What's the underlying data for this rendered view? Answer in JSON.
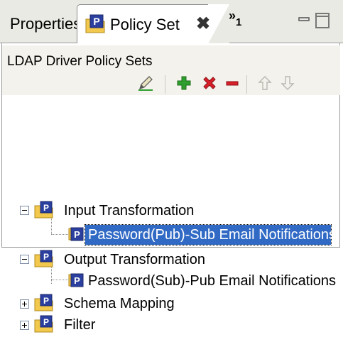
{
  "tabs": {
    "properties_label": "Properties",
    "active_label": "Policy Set",
    "close_glyph": "✖",
    "overflow_glyph": "»",
    "overflow_count": "1"
  },
  "panel": {
    "title": "LDAP Driver Policy Sets"
  },
  "toolbar": {
    "icons": [
      "pencil-edit-icon",
      "add-plus-icon",
      "delete-x-icon",
      "remove-minus-icon",
      "move-up-icon",
      "move-down-icon"
    ],
    "colors": {
      "add": "#2e9e2e",
      "delete": "#d8202a",
      "remove": "#d8202a",
      "disabled": "#b8b8b0"
    }
  },
  "tree": {
    "nodes": [
      {
        "label": "Input Transformation",
        "expanded": true
      },
      {
        "label": "Password(Pub)-Sub Email Notifications",
        "selected": true
      },
      {
        "label": "Output Transformation",
        "expanded": true
      },
      {
        "label": "Password(Sub)-Pub Email Notifications",
        "selected": false
      },
      {
        "label": "Schema Mapping",
        "expanded": false
      },
      {
        "label": "Filter",
        "expanded": false
      }
    ]
  },
  "colors": {
    "selection": "#316ac5",
    "tab_bar": "#eaeae4",
    "header_bg": "#f3f2ec",
    "policy_icon_blue": "#2b3f9e",
    "folder_yellow": "#f2c94c"
  }
}
